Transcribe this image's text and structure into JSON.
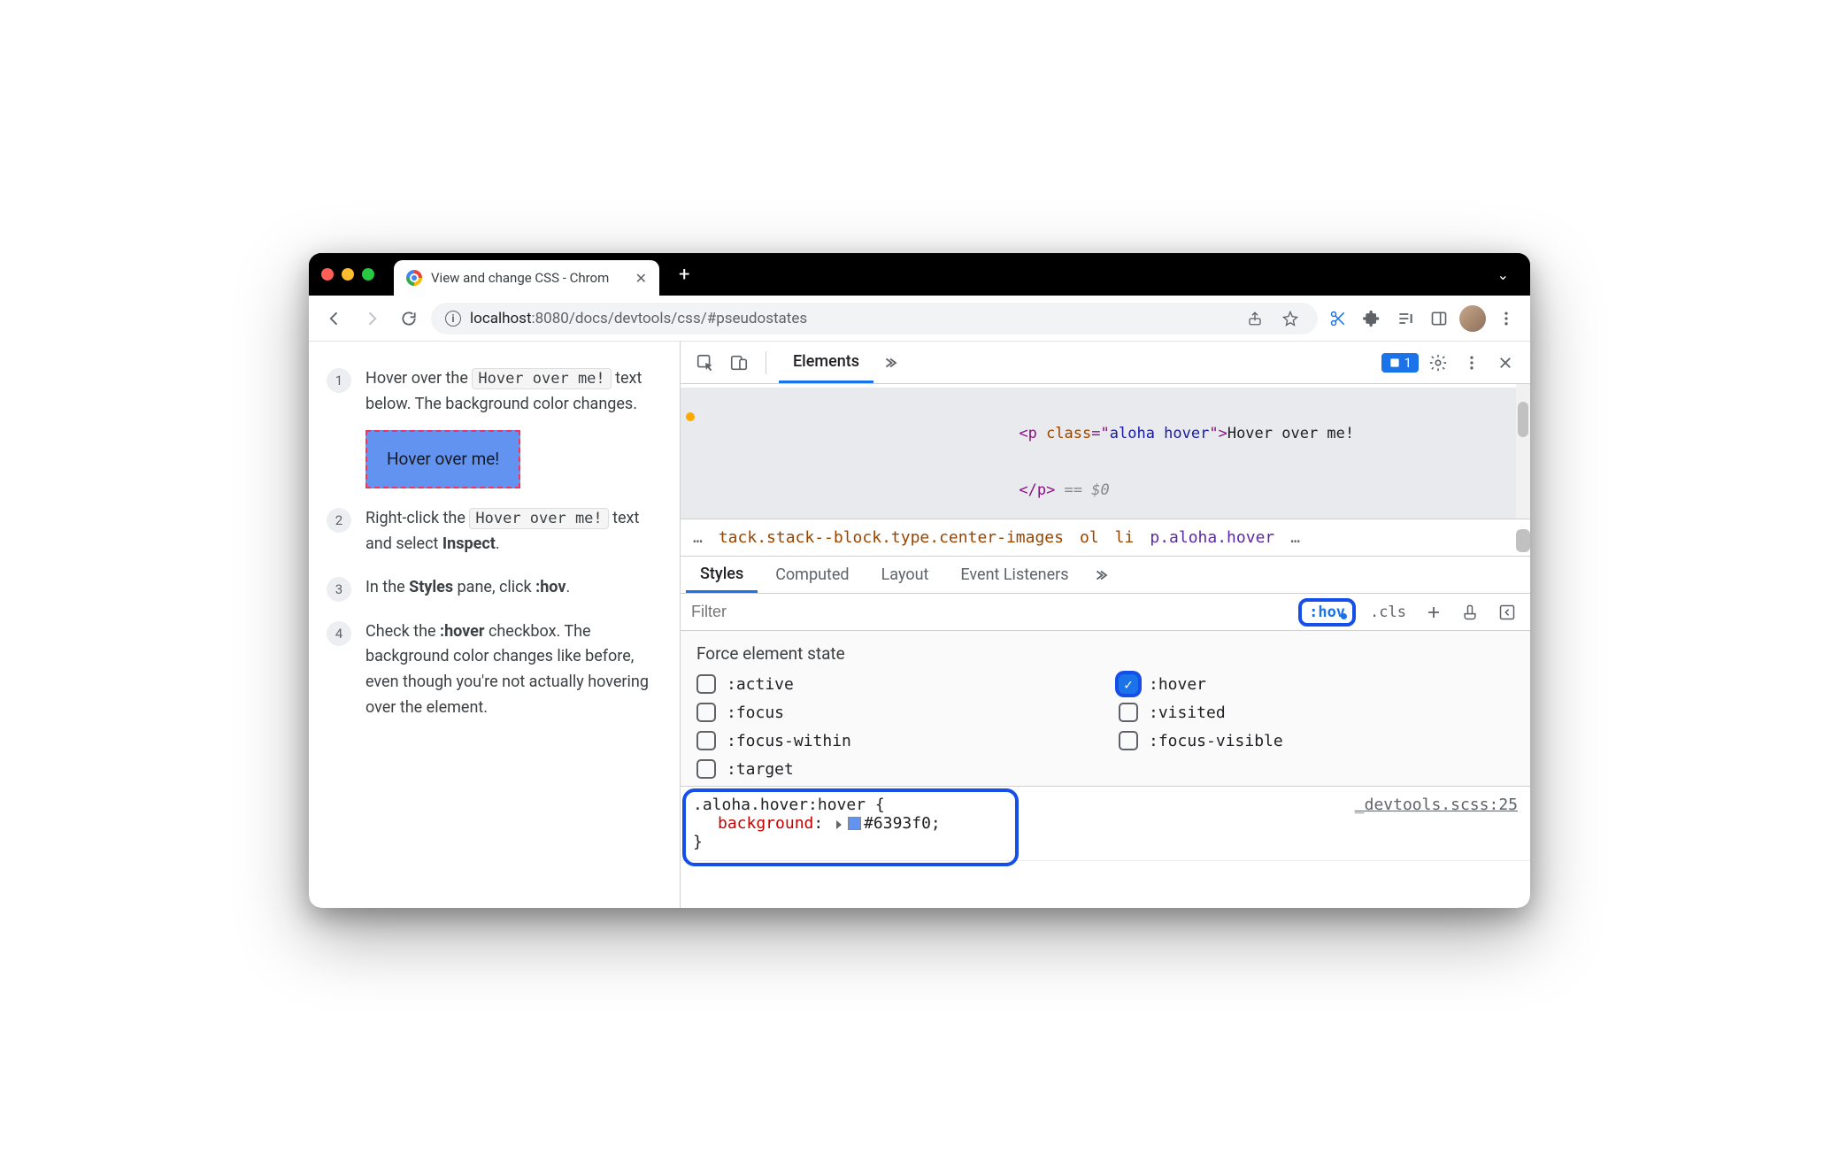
{
  "tab": {
    "title": "View and change CSS - Chrom"
  },
  "url": {
    "host": "localhost",
    "port": ":8080",
    "path": "/docs/devtools/css/#pseudostates"
  },
  "steps": {
    "s1a": "Hover over the ",
    "s1code": "Hover over me!",
    "s1b": " text below. The background color changes.",
    "hoverbox": "Hover over me!",
    "s2a": "Right-click the ",
    "s2code": "Hover over me!",
    "s2b": " text and select ",
    "s2bold": "Inspect",
    "s2c": ".",
    "s3a": "In the ",
    "s3bold": "Styles",
    "s3b": " pane, click ",
    "s3bold2": ":hov",
    "s3c": ".",
    "s4a": "Check the ",
    "s4bold": ":hover",
    "s4b": " checkbox. The background color changes like before, even though you're not actually hovering over the element.",
    "n1": "1",
    "n2": "2",
    "n3": "3",
    "n4": "4"
  },
  "devtools": {
    "top": {
      "elements": "Elements",
      "issues": "1"
    },
    "dom": {
      "line1_pre": "<p ",
      "line1_attr": "class",
      "line1_eq": "=\"",
      "line1_val": "aloha hover",
      "line1_post": "\">",
      "line1_text": "Hover over me!",
      "line2": "</p>",
      "line2_eq": " == ",
      "line2_d": "$0"
    },
    "crumbs": {
      "ell1": "…",
      "c1": "tack.stack--block.type.center-images",
      "c2": "ol",
      "c3": "li",
      "c4": "p.aloha.hover",
      "ell2": "…"
    },
    "subtabs": {
      "styles": "Styles",
      "computed": "Computed",
      "layout": "Layout",
      "listeners": "Event Listeners"
    },
    "stylesbar": {
      "filter": "Filter",
      "hov": ":hov",
      "cls": ".cls"
    },
    "force": {
      "title": "Force element state",
      "active": ":active",
      "hover": ":hover",
      "focus": ":focus",
      "visited": ":visited",
      "focuswithin": ":focus-within",
      "focusvisible": ":focus-visible",
      "target": ":target"
    },
    "rule": {
      "selector": ".aloha.hover:hover",
      "brace_open": " {",
      "prop": "background",
      "colon": ":",
      "value": "#6393f0",
      "semi": ";",
      "brace_close": "}",
      "source": "_devtools.scss:25"
    }
  }
}
